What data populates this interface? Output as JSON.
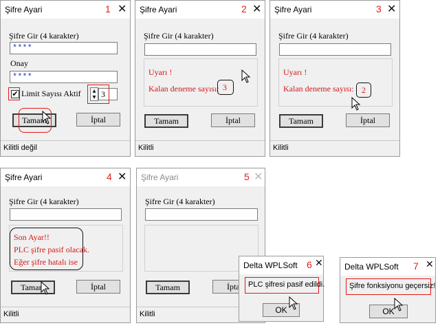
{
  "title": "Şifre Ayari",
  "msg_title": "Delta WPLSoft",
  "close_glyph": "✕",
  "password_label": "Şifre Gir (4 karakter)",
  "confirm_label": "Onay",
  "masked_value": "****",
  "limit_label": "Limit Sayısı Aktif",
  "limit_value": "3",
  "checkbox_mark": "✔",
  "ok_label": "Tamam",
  "cancel_label": "İptal",
  "warning_title": "Uyarı !",
  "remaining_label": "Kalan deneme sayısı:",
  "remaining_counts": [
    "3",
    "2"
  ],
  "last_warning": [
    "Son Ayar!!",
    "PLC şifre pasif olacak.",
    "Eğer şifre hatalı ise"
  ],
  "status_unlocked": "Kilitli değil",
  "status_locked": "Kilitli",
  "msg6_text": "PLC şifresi pasif edildi.",
  "msg7_text": "Şifre fonksiyonu geçersiz!",
  "msg_ok": "OK",
  "step_numbers": [
    "1",
    "2",
    "3",
    "4",
    "5",
    "6",
    "7"
  ],
  "colors": {
    "step_number": "#e0201a",
    "warning_text": "#d41818",
    "masked_text": "#1a3fc0",
    "highlight": "#e01818"
  }
}
